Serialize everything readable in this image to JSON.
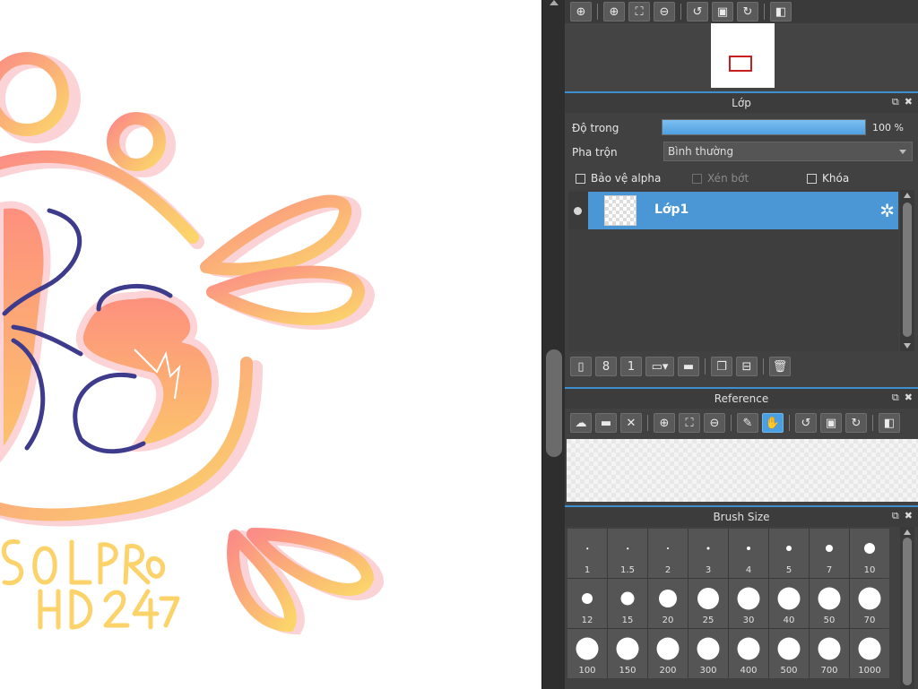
{
  "canvas": {
    "artwork_text_lines": [
      "SOLPRO",
      "HD247"
    ],
    "colors": {
      "stroke_warm": "#fb9c7c",
      "stroke_yellow": "#fbd56a",
      "stroke_shadow": "#fbd3d6",
      "accent_navy": "#3e3a8c"
    }
  },
  "navigator": {
    "toolbar_icons": [
      "zoom-icon",
      "zoom-in-icon",
      "fit-icon",
      "zoom-out-icon",
      "rotate-left-icon",
      "actual-size-icon",
      "rotate-right-icon",
      "flip-icon"
    ]
  },
  "layer_panel": {
    "title": "Lớp",
    "opacity_label": "Độ trong",
    "opacity_value": "100 %",
    "opacity_fraction": 1.0,
    "blend_label": "Pha trộn",
    "blend_value": "Bình thường",
    "protect_alpha": "Bảo vệ alpha",
    "clipping": "Xén bớt",
    "lock": "Khóa",
    "layers": [
      {
        "name": "Lớp1",
        "selected": true
      }
    ],
    "toolbar_icons": [
      "new-layer-icon",
      "new-8bit-layer-icon",
      "new-1bit-layer-icon",
      "add-layer-menu-icon",
      "folder-icon",
      "duplicate-layer-icon",
      "merge-down-icon",
      "delete-layer-icon"
    ]
  },
  "reference_panel": {
    "title": "Reference",
    "toolbar_icons": [
      "upload-icon",
      "open-folder-icon",
      "close-icon",
      "zoom-in-icon",
      "fit-icon",
      "zoom-out-icon",
      "eyedropper-icon",
      "hand-icon",
      "rotate-left-icon",
      "actual-size-icon",
      "rotate-right-icon",
      "flip-icon"
    ]
  },
  "brush_panel": {
    "title": "Brush Size",
    "sizes": [
      "1",
      "1.5",
      "2",
      "3",
      "4",
      "5",
      "7",
      "10",
      "12",
      "15",
      "20",
      "25",
      "30",
      "40",
      "50",
      "70",
      "100",
      "150",
      "200",
      "300",
      "400",
      "500",
      "700",
      "1000"
    ]
  },
  "theme": {
    "accent": "#3e8fd0",
    "selection": "#4b97d6",
    "panel_bg": "#414141"
  }
}
